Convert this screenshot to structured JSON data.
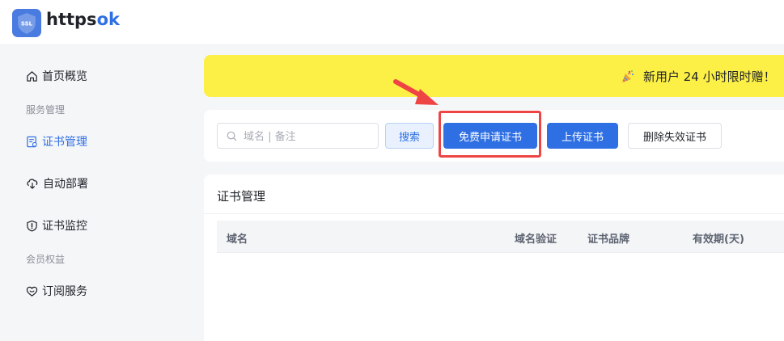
{
  "app": {
    "logo_badge_text": "SSL",
    "name_part1": "https",
    "name_part2": "ok"
  },
  "sidebar": {
    "items": [
      {
        "label": "首页概览",
        "icon": "home-icon"
      },
      {
        "label": "服务管理",
        "type": "group"
      },
      {
        "label": "证书管理",
        "icon": "certificate-icon",
        "active": true
      },
      {
        "label": "自动部署",
        "icon": "deploy-icon"
      },
      {
        "label": "证书监控",
        "icon": "shield-icon"
      },
      {
        "label": "会员权益",
        "type": "group"
      },
      {
        "label": "订阅服务",
        "icon": "heart-icon"
      }
    ]
  },
  "banner": {
    "icon": "party-popper-icon",
    "text": "新用户 24 小时限时赠！"
  },
  "toolbar": {
    "search_placeholder": "域名 | 备注",
    "search_value": "",
    "search_button": "搜索",
    "apply_button": "免费申请证书",
    "upload_button": "上传证书",
    "delete_button": "删除失效证书"
  },
  "annotation": {
    "arrow_icon": "red-arrow-icon",
    "highlight_color": "#ef4444"
  },
  "card": {
    "title": "证书管理",
    "columns": [
      "域名",
      "域名验证",
      "证书品牌",
      "有效期(天)"
    ]
  },
  "colors": {
    "primary": "#2f6fe4",
    "banner": "#fcef45",
    "highlight": "#ef4444"
  }
}
